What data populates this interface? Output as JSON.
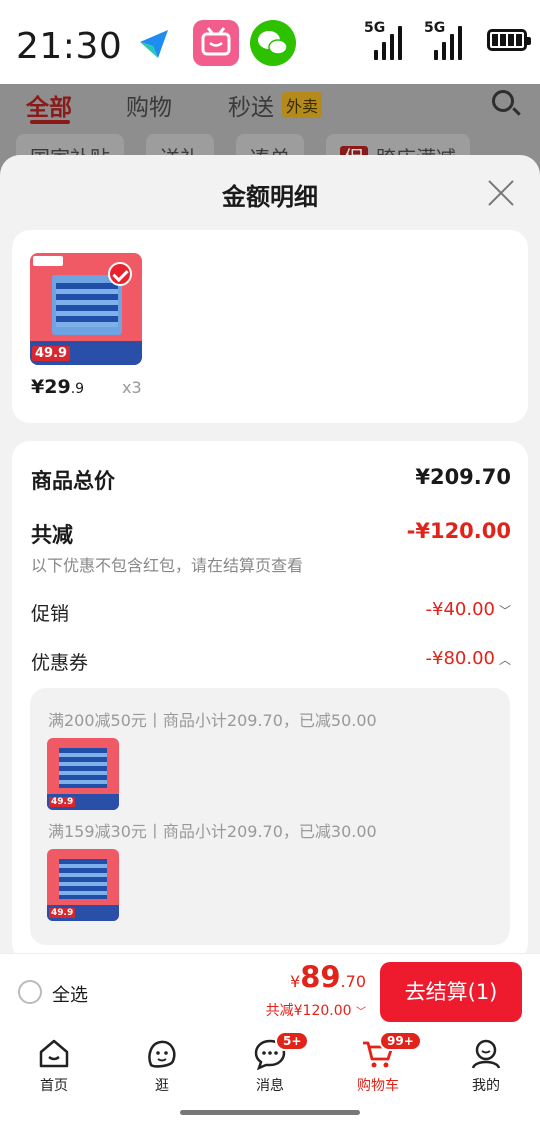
{
  "status_bar": {
    "time": "21:30",
    "signal_1": "5G",
    "signal_2": "5G"
  },
  "background_page": {
    "tabs": [
      "全部",
      "购物",
      "秒送"
    ],
    "tab_badge": "外卖",
    "chips": [
      "国家补贴",
      "送礼",
      "凑单",
      "跨店满减"
    ],
    "chip_tag": "促"
  },
  "sheet": {
    "title": "金额明细",
    "product": {
      "price_symbol": "¥",
      "price_int": "29",
      "price_dec": ".9",
      "qty": "x3",
      "image_tag": "49.9"
    },
    "details": {
      "total_label": "商品总价",
      "total_value": "¥209.70",
      "discount_label": "共减",
      "discount_value": "-¥120.00",
      "discount_note": "以下优惠不包含红包，请在结算页查看",
      "promo_label": "促销",
      "promo_value": "-¥40.00",
      "coupon_label": "优惠券",
      "coupon_value": "-¥80.00",
      "coupon_lines": [
        "满200减50元丨商品小计209.70，已减50.00",
        "满159减30元丨商品小计209.70，已减30.00"
      ]
    }
  },
  "checkout": {
    "select_all": "全选",
    "currency": "¥",
    "total_int": "89",
    "total_dec": ".70",
    "saved": "共减¥120.00",
    "pay_button": "去结算(1)"
  },
  "tabbar": {
    "items": [
      {
        "label": "首页"
      },
      {
        "label": "逛"
      },
      {
        "label": "消息",
        "badge": "5+"
      },
      {
        "label": "购物车",
        "badge": "99+"
      },
      {
        "label": "我的"
      }
    ]
  },
  "colors": {
    "accent": "#e2231a",
    "button": "#ee1b2e"
  }
}
